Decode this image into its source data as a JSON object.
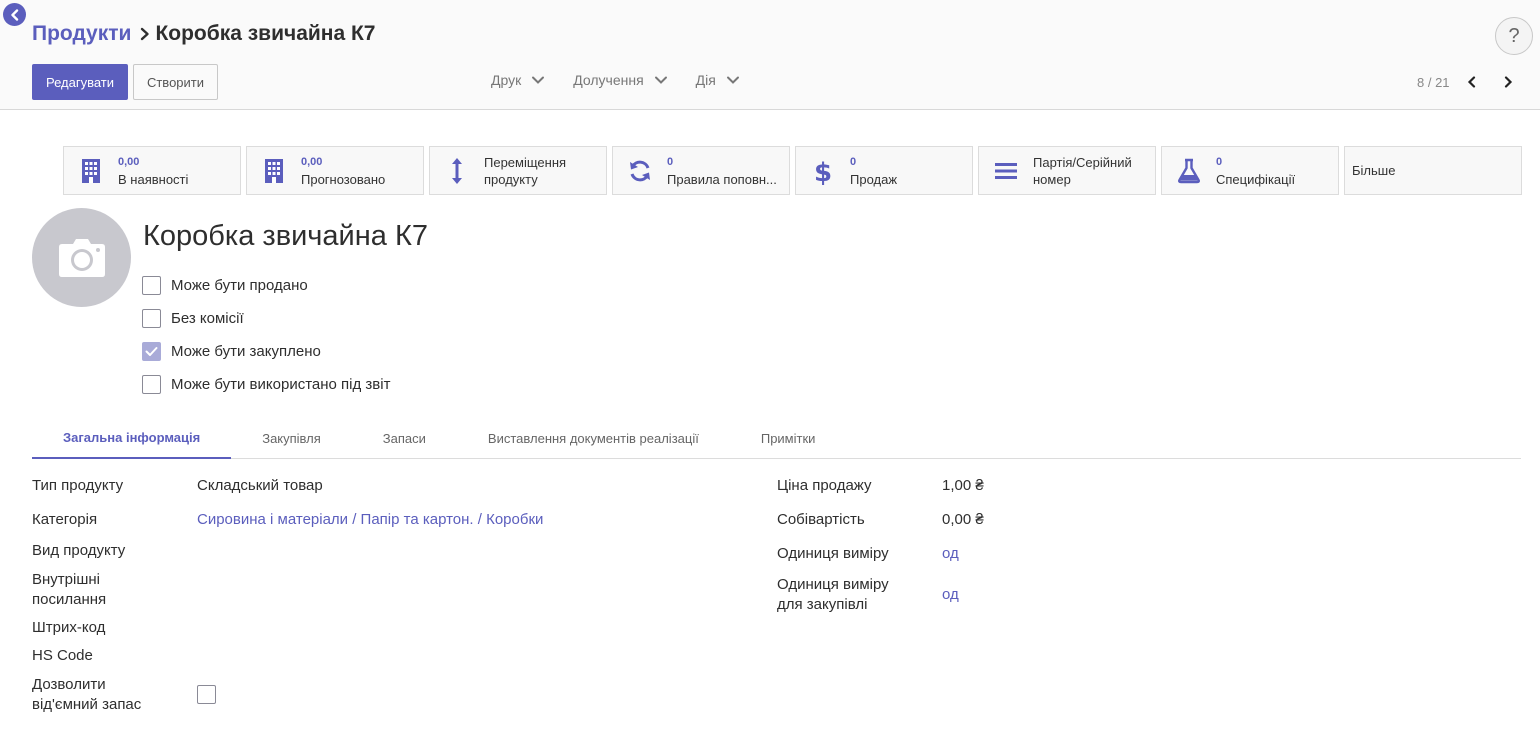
{
  "breadcrumb": {
    "parent": "Продукти",
    "current": "Коробка звичайна К7"
  },
  "toolbar": {
    "edit_label": "Редагувати",
    "create_label": "Створити",
    "help_label": "?"
  },
  "dropdowns": [
    "Друк",
    "Долучення",
    "Дія"
  ],
  "pager": {
    "text": "8 / 21"
  },
  "smart_buttons": [
    {
      "value": "0,00",
      "label": "В наявності",
      "icon": "building-icon"
    },
    {
      "value": "0,00",
      "label": "Прогнозовано",
      "icon": "building-icon"
    },
    {
      "value": "",
      "label": "Переміщення продукту",
      "line1": "Переміщення",
      "line2": "продукту",
      "icon": "arrows-vertical-icon"
    },
    {
      "value": "0",
      "label": "Правила поповн...",
      "icon": "refresh-icon"
    },
    {
      "value": "0",
      "label": "Продаж",
      "icon": "dollar-icon"
    },
    {
      "value": "",
      "label": "Партія/Серійний номер",
      "line1": "Партія/Серійний",
      "line2": "номер",
      "icon": "list-icon"
    },
    {
      "value": "0",
      "label": "Специфікації",
      "icon": "flask-icon"
    }
  ],
  "more_label": "Більше",
  "product": {
    "name": "Коробка звичайна К7",
    "checkboxes": [
      {
        "label": "Може бути продано",
        "checked": false
      },
      {
        "label": "Без комісії",
        "checked": false
      },
      {
        "label": "Може бути закуплено",
        "checked": true
      },
      {
        "label": "Може бути використано під звіт",
        "checked": false
      }
    ]
  },
  "tabs": [
    "Загальна інформація",
    "Закупівля",
    "Запаси",
    "Виставлення документів реалізації",
    "Примітки"
  ],
  "left_fields": {
    "product_type": {
      "label": "Тип продукту",
      "value": "Складський товар"
    },
    "category": {
      "label": "Категорія",
      "value": "Сировина і матеріали / Папір та картон. / Коробки"
    },
    "product_kind": {
      "label": "Вид продукту"
    },
    "internal_ref": {
      "label_line1": "Внутрішні",
      "label_line2": "посилання"
    },
    "barcode": {
      "label": "Штрих-код"
    },
    "hs_code": {
      "label": "HS Code"
    },
    "negative_stock": {
      "label_line1": "Дозволити",
      "label_line2": "від'ємний запас",
      "checked": false
    }
  },
  "right_fields": {
    "sale_price": {
      "label": "Ціна продажу",
      "value": "1,00 ₴"
    },
    "cost": {
      "label": "Собівартість",
      "value": "0,00 ₴"
    },
    "uom": {
      "label": "Одиниця виміру",
      "value": "од"
    },
    "purchase_uom": {
      "label_line1": "Одиниця виміру",
      "label_line2": "для закупівлі",
      "value": "од"
    }
  },
  "colors": {
    "accent": "#5b5ebd",
    "checkbox_checked": "#a9abd8",
    "avatar_bg": "#c8c8ce"
  }
}
